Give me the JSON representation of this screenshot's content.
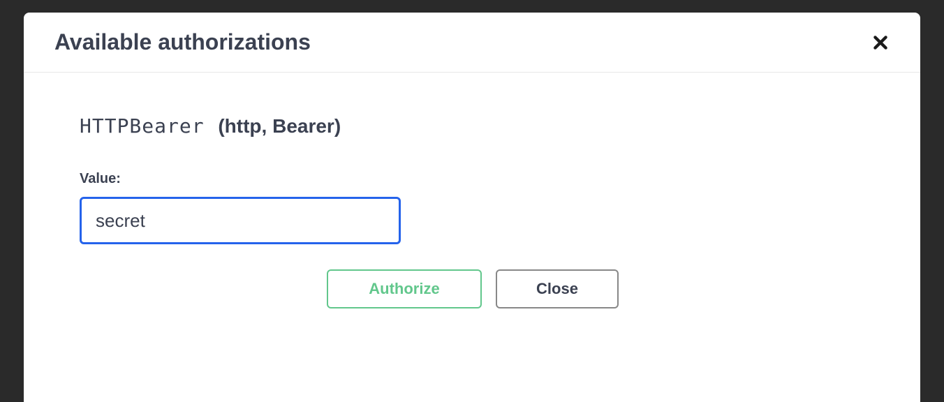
{
  "modal": {
    "title": "Available authorizations"
  },
  "scheme": {
    "name": "HTTPBearer",
    "type_label": "(http, Bearer)"
  },
  "form": {
    "value_label": "Value:",
    "value": "secret"
  },
  "buttons": {
    "authorize": "Authorize",
    "close": "Close"
  }
}
